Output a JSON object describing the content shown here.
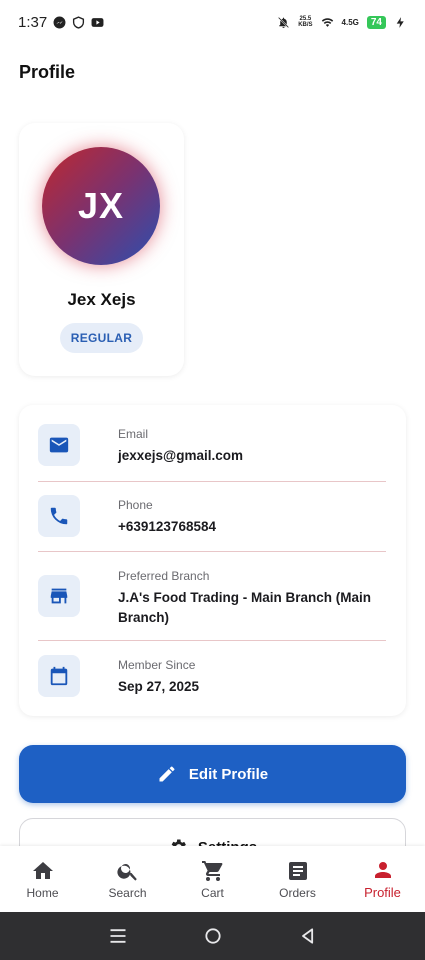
{
  "status_bar": {
    "time": "1:37",
    "net_speed_value": "25.5",
    "net_speed_unit": "KB/S",
    "network": "4.5G",
    "battery": "74"
  },
  "page": {
    "title": "Profile"
  },
  "profile": {
    "initials": "JX",
    "name": "Jex Xejs",
    "tier": "REGULAR",
    "accent_color": "#1e60c4",
    "active_color": "#c8202e"
  },
  "info": {
    "email": {
      "label": "Email",
      "value": "jexxejs@gmail.com",
      "icon": "mail-icon"
    },
    "phone": {
      "label": "Phone",
      "value": "+639123768584",
      "icon": "phone-icon"
    },
    "branch": {
      "label": "Preferred Branch",
      "value": "J.A's Food Trading - Main Branch (Main Branch)",
      "icon": "store-icon"
    },
    "member_since": {
      "label": "Member Since",
      "value": "Sep 27, 2025",
      "icon": "calendar-icon"
    }
  },
  "actions": {
    "edit_profile_label": "Edit Profile",
    "settings_label": "Settings"
  },
  "bottom_nav": [
    {
      "label": "Home",
      "icon": "home-icon"
    },
    {
      "label": "Search",
      "icon": "search-icon"
    },
    {
      "label": "Cart",
      "icon": "cart-icon"
    },
    {
      "label": "Orders",
      "icon": "orders-icon"
    },
    {
      "label": "Profile",
      "icon": "person-icon",
      "active": true
    }
  ]
}
